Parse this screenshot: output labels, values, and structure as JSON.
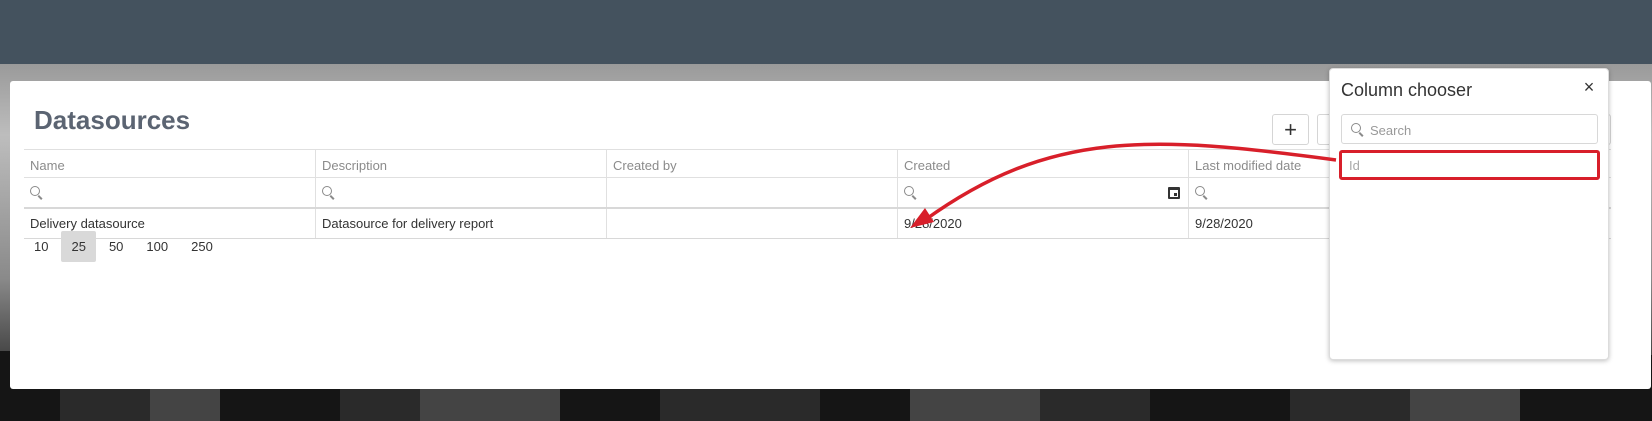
{
  "page": {
    "title": "Datasources"
  },
  "toolbar": {
    "add_label": "+"
  },
  "grid": {
    "columns": [
      "Name",
      "Description",
      "Created by",
      "Created",
      "Last modified date"
    ],
    "rows": [
      {
        "name": "Delivery datasource",
        "description": "Datasource for delivery report",
        "created_by": "",
        "created": "9/28/2020",
        "modified": "9/28/2020"
      }
    ]
  },
  "pager": {
    "sizes": [
      "10",
      "25",
      "50",
      "100",
      "250"
    ],
    "selected": "25"
  },
  "column_chooser": {
    "title": "Column chooser",
    "close_label": "×",
    "search_placeholder": "Search",
    "items": [
      "Id"
    ]
  },
  "annotation": {
    "color": "#d81f2a"
  },
  "colors": {
    "topbar": "#44525e",
    "title": "#5b6472"
  },
  "icons": [
    "search-icon",
    "calendar-icon",
    "close-icon",
    "plus-icon"
  ]
}
